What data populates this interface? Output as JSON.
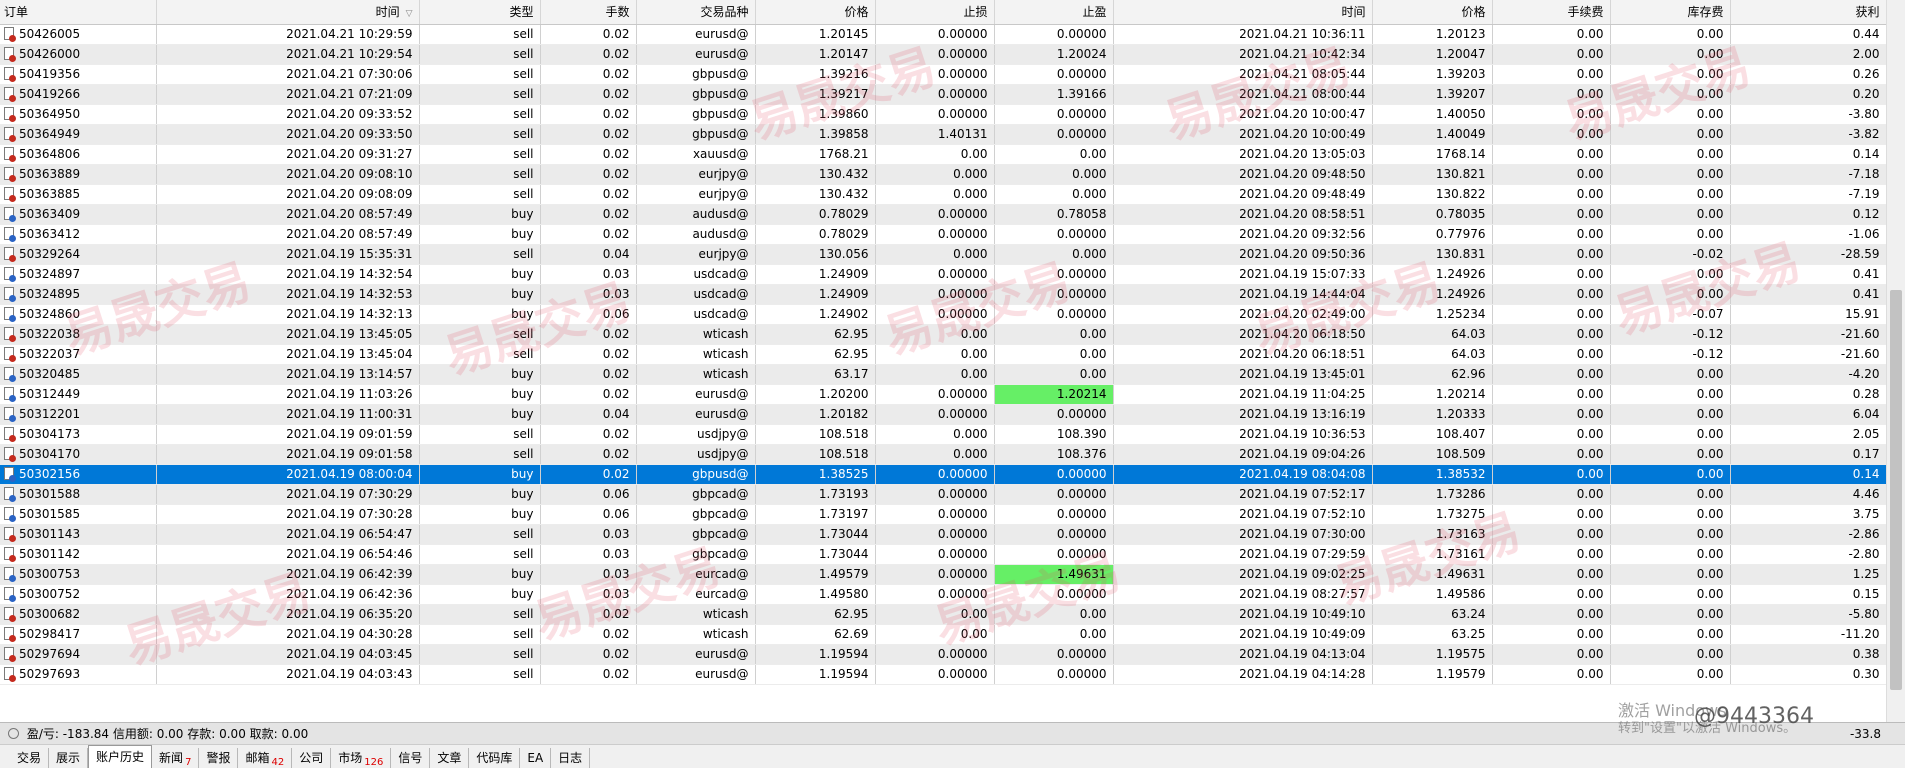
{
  "columns": [
    "订单",
    "时间",
    "类型",
    "手数",
    "交易品种",
    "价格",
    "止损",
    "止盈",
    "时间",
    "价格",
    "手续费",
    "库存费",
    "获利"
  ],
  "rows": [
    {
      "order": "50426005",
      "open_time": "2021.04.21 10:29:59",
      "type": "sell",
      "lots": "0.02",
      "symbol": "eurusd@",
      "open_price": "1.20145",
      "sl": "0.00000",
      "tp": "0.00000",
      "close_time": "2021.04.21 10:36:11",
      "close_price": "1.20123",
      "commission": "0.00",
      "swap": "0.00",
      "profit": "0.44"
    },
    {
      "order": "50426000",
      "open_time": "2021.04.21 10:29:54",
      "type": "sell",
      "lots": "0.02",
      "symbol": "eurusd@",
      "open_price": "1.20147",
      "sl": "0.00000",
      "tp": "1.20024",
      "close_time": "2021.04.21 10:42:34",
      "close_price": "1.20047",
      "commission": "0.00",
      "swap": "0.00",
      "profit": "2.00"
    },
    {
      "order": "50419356",
      "open_time": "2021.04.21 07:30:06",
      "type": "sell",
      "lots": "0.02",
      "symbol": "gbpusd@",
      "open_price": "1.39216",
      "sl": "0.00000",
      "tp": "0.00000",
      "close_time": "2021.04.21 08:05:44",
      "close_price": "1.39203",
      "commission": "0.00",
      "swap": "0.00",
      "profit": "0.26"
    },
    {
      "order": "50419266",
      "open_time": "2021.04.21 07:21:09",
      "type": "sell",
      "lots": "0.02",
      "symbol": "gbpusd@",
      "open_price": "1.39217",
      "sl": "0.00000",
      "tp": "1.39166",
      "close_time": "2021.04.21 08:00:44",
      "close_price": "1.39207",
      "commission": "0.00",
      "swap": "0.00",
      "profit": "0.20"
    },
    {
      "order": "50364950",
      "open_time": "2021.04.20 09:33:52",
      "type": "sell",
      "lots": "0.02",
      "symbol": "gbpusd@",
      "open_price": "1.39860",
      "sl": "0.00000",
      "tp": "0.00000",
      "close_time": "2021.04.20 10:00:47",
      "close_price": "1.40050",
      "commission": "0.00",
      "swap": "0.00",
      "profit": "-3.80"
    },
    {
      "order": "50364949",
      "open_time": "2021.04.20 09:33:50",
      "type": "sell",
      "lots": "0.02",
      "symbol": "gbpusd@",
      "open_price": "1.39858",
      "sl": "1.40131",
      "tp": "0.00000",
      "close_time": "2021.04.20 10:00:49",
      "close_price": "1.40049",
      "commission": "0.00",
      "swap": "0.00",
      "profit": "-3.82"
    },
    {
      "order": "50364806",
      "open_time": "2021.04.20 09:31:27",
      "type": "sell",
      "lots": "0.02",
      "symbol": "xauusd@",
      "open_price": "1768.21",
      "sl": "0.00",
      "tp": "0.00",
      "close_time": "2021.04.20 13:05:03",
      "close_price": "1768.14",
      "commission": "0.00",
      "swap": "0.00",
      "profit": "0.14"
    },
    {
      "order": "50363889",
      "open_time": "2021.04.20 09:08:10",
      "type": "sell",
      "lots": "0.02",
      "symbol": "eurjpy@",
      "open_price": "130.432",
      "sl": "0.000",
      "tp": "0.000",
      "close_time": "2021.04.20 09:48:50",
      "close_price": "130.821",
      "commission": "0.00",
      "swap": "0.00",
      "profit": "-7.18"
    },
    {
      "order": "50363885",
      "open_time": "2021.04.20 09:08:09",
      "type": "sell",
      "lots": "0.02",
      "symbol": "eurjpy@",
      "open_price": "130.432",
      "sl": "0.000",
      "tp": "0.000",
      "close_time": "2021.04.20 09:48:49",
      "close_price": "130.822",
      "commission": "0.00",
      "swap": "0.00",
      "profit": "-7.19"
    },
    {
      "order": "50363409",
      "open_time": "2021.04.20 08:57:49",
      "type": "buy",
      "lots": "0.02",
      "symbol": "audusd@",
      "open_price": "0.78029",
      "sl": "0.00000",
      "tp": "0.78058",
      "close_time": "2021.04.20 08:58:51",
      "close_price": "0.78035",
      "commission": "0.00",
      "swap": "0.00",
      "profit": "0.12"
    },
    {
      "order": "50363412",
      "open_time": "2021.04.20 08:57:49",
      "type": "buy",
      "lots": "0.02",
      "symbol": "audusd@",
      "open_price": "0.78029",
      "sl": "0.00000",
      "tp": "0.00000",
      "close_time": "2021.04.20 09:32:56",
      "close_price": "0.77976",
      "commission": "0.00",
      "swap": "0.00",
      "profit": "-1.06"
    },
    {
      "order": "50329264",
      "open_time": "2021.04.19 15:35:31",
      "type": "sell",
      "lots": "0.04",
      "symbol": "eurjpy@",
      "open_price": "130.056",
      "sl": "0.000",
      "tp": "0.000",
      "close_time": "2021.04.20 09:50:36",
      "close_price": "130.831",
      "commission": "0.00",
      "swap": "-0.02",
      "profit": "-28.59"
    },
    {
      "order": "50324897",
      "open_time": "2021.04.19 14:32:54",
      "type": "buy",
      "lots": "0.03",
      "symbol": "usdcad@",
      "open_price": "1.24909",
      "sl": "0.00000",
      "tp": "0.00000",
      "close_time": "2021.04.19 15:07:33",
      "close_price": "1.24926",
      "commission": "0.00",
      "swap": "0.00",
      "profit": "0.41"
    },
    {
      "order": "50324895",
      "open_time": "2021.04.19 14:32:53",
      "type": "buy",
      "lots": "0.03",
      "symbol": "usdcad@",
      "open_price": "1.24909",
      "sl": "0.00000",
      "tp": "0.00000",
      "close_time": "2021.04.19 14:44:04",
      "close_price": "1.24926",
      "commission": "0.00",
      "swap": "0.00",
      "profit": "0.41"
    },
    {
      "order": "50324860",
      "open_time": "2021.04.19 14:32:13",
      "type": "buy",
      "lots": "0.06",
      "symbol": "usdcad@",
      "open_price": "1.24902",
      "sl": "0.00000",
      "tp": "0.00000",
      "close_time": "2021.04.20 02:49:00",
      "close_price": "1.25234",
      "commission": "0.00",
      "swap": "-0.07",
      "profit": "15.91"
    },
    {
      "order": "50322038",
      "open_time": "2021.04.19 13:45:05",
      "type": "sell",
      "lots": "0.02",
      "symbol": "wticash",
      "open_price": "62.95",
      "sl": "0.00",
      "tp": "0.00",
      "close_time": "2021.04.20 06:18:50",
      "close_price": "64.03",
      "commission": "0.00",
      "swap": "-0.12",
      "profit": "-21.60"
    },
    {
      "order": "50322037",
      "open_time": "2021.04.19 13:45:04",
      "type": "sell",
      "lots": "0.02",
      "symbol": "wticash",
      "open_price": "62.95",
      "sl": "0.00",
      "tp": "0.00",
      "close_time": "2021.04.20 06:18:51",
      "close_price": "64.03",
      "commission": "0.00",
      "swap": "-0.12",
      "profit": "-21.60"
    },
    {
      "order": "50320485",
      "open_time": "2021.04.19 13:14:57",
      "type": "buy",
      "lots": "0.02",
      "symbol": "wticash",
      "open_price": "63.17",
      "sl": "0.00",
      "tp": "0.00",
      "close_time": "2021.04.19 13:45:01",
      "close_price": "62.96",
      "commission": "0.00",
      "swap": "0.00",
      "profit": "-4.20"
    },
    {
      "order": "50312449",
      "open_time": "2021.04.19 11:03:26",
      "type": "buy",
      "lots": "0.02",
      "symbol": "eurusd@",
      "open_price": "1.20200",
      "sl": "0.00000",
      "tp": "1.20214",
      "close_time": "2021.04.19 11:04:25",
      "close_price": "1.20214",
      "commission": "0.00",
      "swap": "0.00",
      "profit": "0.28",
      "tp_hit": true
    },
    {
      "order": "50312201",
      "open_time": "2021.04.19 11:00:31",
      "type": "buy",
      "lots": "0.04",
      "symbol": "eurusd@",
      "open_price": "1.20182",
      "sl": "0.00000",
      "tp": "0.00000",
      "close_time": "2021.04.19 13:16:19",
      "close_price": "1.20333",
      "commission": "0.00",
      "swap": "0.00",
      "profit": "6.04"
    },
    {
      "order": "50304173",
      "open_time": "2021.04.19 09:01:59",
      "type": "sell",
      "lots": "0.02",
      "symbol": "usdjpy@",
      "open_price": "108.518",
      "sl": "0.000",
      "tp": "108.390",
      "close_time": "2021.04.19 10:36:53",
      "close_price": "108.407",
      "commission": "0.00",
      "swap": "0.00",
      "profit": "2.05"
    },
    {
      "order": "50304170",
      "open_time": "2021.04.19 09:01:58",
      "type": "sell",
      "lots": "0.02",
      "symbol": "usdjpy@",
      "open_price": "108.518",
      "sl": "0.000",
      "tp": "108.376",
      "close_time": "2021.04.19 09:04:26",
      "close_price": "108.509",
      "commission": "0.00",
      "swap": "0.00",
      "profit": "0.17"
    },
    {
      "order": "50302156",
      "open_time": "2021.04.19 08:00:04",
      "type": "buy",
      "lots": "0.02",
      "symbol": "gbpusd@",
      "open_price": "1.38525",
      "sl": "0.00000",
      "tp": "0.00000",
      "close_time": "2021.04.19 08:04:08",
      "close_price": "1.38532",
      "commission": "0.00",
      "swap": "0.00",
      "profit": "0.14",
      "selected": true
    },
    {
      "order": "50301588",
      "open_time": "2021.04.19 07:30:29",
      "type": "buy",
      "lots": "0.06",
      "symbol": "gbpcad@",
      "open_price": "1.73193",
      "sl": "0.00000",
      "tp": "0.00000",
      "close_time": "2021.04.19 07:52:17",
      "close_price": "1.73286",
      "commission": "0.00",
      "swap": "0.00",
      "profit": "4.46"
    },
    {
      "order": "50301585",
      "open_time": "2021.04.19 07:30:28",
      "type": "buy",
      "lots": "0.06",
      "symbol": "gbpcad@",
      "open_price": "1.73197",
      "sl": "0.00000",
      "tp": "0.00000",
      "close_time": "2021.04.19 07:52:10",
      "close_price": "1.73275",
      "commission": "0.00",
      "swap": "0.00",
      "profit": "3.75"
    },
    {
      "order": "50301143",
      "open_time": "2021.04.19 06:54:47",
      "type": "sell",
      "lots": "0.03",
      "symbol": "gbpcad@",
      "open_price": "1.73044",
      "sl": "0.00000",
      "tp": "0.00000",
      "close_time": "2021.04.19 07:30:00",
      "close_price": "1.73163",
      "commission": "0.00",
      "swap": "0.00",
      "profit": "-2.86"
    },
    {
      "order": "50301142",
      "open_time": "2021.04.19 06:54:46",
      "type": "sell",
      "lots": "0.03",
      "symbol": "gbpcad@",
      "open_price": "1.73044",
      "sl": "0.00000",
      "tp": "0.00000",
      "close_time": "2021.04.19 07:29:59",
      "close_price": "1.73161",
      "commission": "0.00",
      "swap": "0.00",
      "profit": "-2.80"
    },
    {
      "order": "50300753",
      "open_time": "2021.04.19 06:42:39",
      "type": "buy",
      "lots": "0.03",
      "symbol": "eurcad@",
      "open_price": "1.49579",
      "sl": "0.00000",
      "tp": "1.49631",
      "close_time": "2021.04.19 09:02:25",
      "close_price": "1.49631",
      "commission": "0.00",
      "swap": "0.00",
      "profit": "1.25",
      "tp_hit": true
    },
    {
      "order": "50300752",
      "open_time": "2021.04.19 06:42:36",
      "type": "buy",
      "lots": "0.03",
      "symbol": "eurcad@",
      "open_price": "1.49580",
      "sl": "0.00000",
      "tp": "0.00000",
      "close_time": "2021.04.19 08:27:57",
      "close_price": "1.49586",
      "commission": "0.00",
      "swap": "0.00",
      "profit": "0.15"
    },
    {
      "order": "50300682",
      "open_time": "2021.04.19 06:35:20",
      "type": "sell",
      "lots": "0.02",
      "symbol": "wticash",
      "open_price": "62.95",
      "sl": "0.00",
      "tp": "0.00",
      "close_time": "2021.04.19 10:49:10",
      "close_price": "63.24",
      "commission": "0.00",
      "swap": "0.00",
      "profit": "-5.80"
    },
    {
      "order": "50298417",
      "open_time": "2021.04.19 04:30:28",
      "type": "sell",
      "lots": "0.02",
      "symbol": "wticash",
      "open_price": "62.69",
      "sl": "0.00",
      "tp": "0.00",
      "close_time": "2021.04.19 10:49:09",
      "close_price": "63.25",
      "commission": "0.00",
      "swap": "0.00",
      "profit": "-11.20"
    },
    {
      "order": "50297694",
      "open_time": "2021.04.19 04:03:45",
      "type": "sell",
      "lots": "0.02",
      "symbol": "eurusd@",
      "open_price": "1.19594",
      "sl": "0.00000",
      "tp": "0.00000",
      "close_time": "2021.04.19 04:13:04",
      "close_price": "1.19575",
      "commission": "0.00",
      "swap": "0.00",
      "profit": "0.38"
    },
    {
      "order": "50297693",
      "open_time": "2021.04.19 04:03:43",
      "type": "sell",
      "lots": "0.02",
      "symbol": "eurusd@",
      "open_price": "1.19594",
      "sl": "0.00000",
      "tp": "0.00000",
      "close_time": "2021.04.19 04:14:28",
      "close_price": "1.19579",
      "commission": "0.00",
      "swap": "0.00",
      "profit": "0.30"
    }
  ],
  "summary": {
    "text": "盈/亏: -183.84  信用额: 0.00  存款: 0.00  取款: 0.00",
    "total": "-33.8"
  },
  "tabs": [
    {
      "label": "交易"
    },
    {
      "label": "展示"
    },
    {
      "label": "账户历史",
      "active": true
    },
    {
      "label": "新闻",
      "badge": "7"
    },
    {
      "label": "警报"
    },
    {
      "label": "邮箱",
      "badge": "42"
    },
    {
      "label": "公司"
    },
    {
      "label": "市场",
      "badge": "126"
    },
    {
      "label": "信号"
    },
    {
      "label": "文章"
    },
    {
      "label": "代码库"
    },
    {
      "label": "EA"
    },
    {
      "label": "日志"
    }
  ],
  "watermark": "易晟交易",
  "os_notice": {
    "title": "激活 Windows",
    "subtitle": "转到\"设置\"以激活 Windows。"
  },
  "handle": "@9443364",
  "colors": {
    "selected_row": "#0078d7",
    "tp_hit": "#66ef66",
    "sell_icon": "#c42a1e",
    "buy_icon": "#2a63c4"
  }
}
